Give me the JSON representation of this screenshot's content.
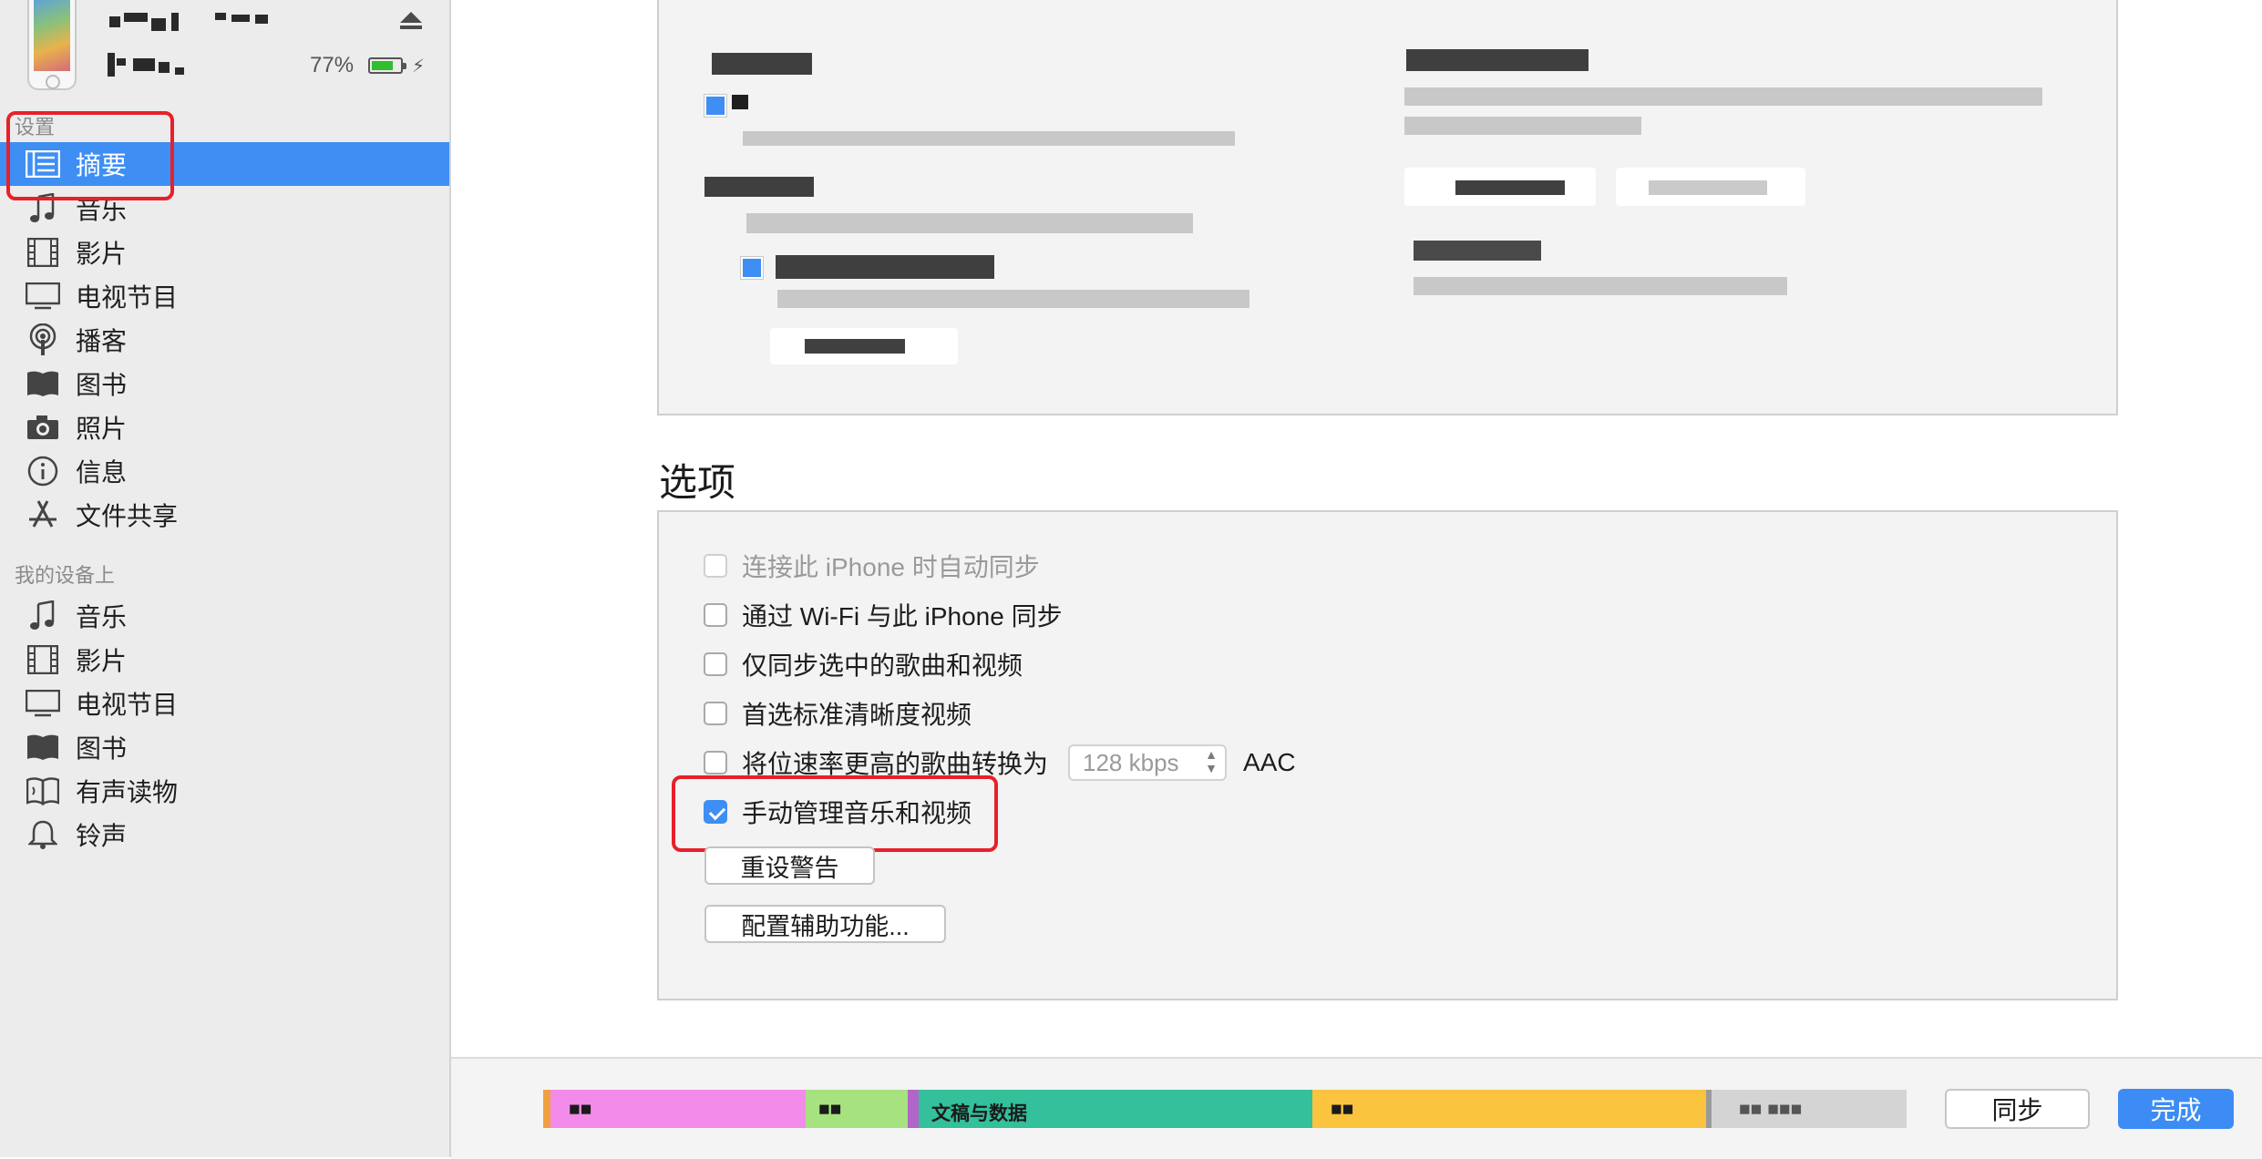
{
  "device": {
    "name_redacted": "■■■ ■■■■",
    "capacity_redacted": "■ ■■■",
    "battery_percent": "77%",
    "battery_level": 0.77,
    "charging_glyph": "⚡"
  },
  "sidebar": {
    "settings_header": "设置",
    "settings_items": [
      {
        "label": "摘要",
        "icon": "list-icon",
        "selected": true
      },
      {
        "label": "音乐",
        "icon": "music-note-icon"
      },
      {
        "label": "影片",
        "icon": "film-icon"
      },
      {
        "label": "电视节目",
        "icon": "tv-icon"
      },
      {
        "label": "播客",
        "icon": "podcast-icon"
      },
      {
        "label": "图书",
        "icon": "book-icon"
      },
      {
        "label": "照片",
        "icon": "camera-icon"
      },
      {
        "label": "信息",
        "icon": "info-icon"
      },
      {
        "label": "文件共享",
        "icon": "app-store-icon"
      }
    ],
    "on_device_header": "我的设备上",
    "device_items": [
      {
        "label": "音乐",
        "icon": "music-note-icon"
      },
      {
        "label": "影片",
        "icon": "film-icon"
      },
      {
        "label": "电视节目",
        "icon": "tv-icon"
      },
      {
        "label": "图书",
        "icon": "book-icon"
      },
      {
        "label": "有声读物",
        "icon": "audiobook-icon"
      },
      {
        "label": "铃声",
        "icon": "bell-icon"
      }
    ]
  },
  "backup_panel": {
    "note": "content pixelated/redacted in screenshot"
  },
  "options": {
    "title": "选项",
    "items": [
      {
        "label": "连接此 iPhone 时自动同步",
        "checked": false,
        "disabled": true
      },
      {
        "label": "通过 Wi-Fi 与此 iPhone 同步",
        "checked": false,
        "disabled": false
      },
      {
        "label": "仅同步选中的歌曲和视频",
        "checked": false,
        "disabled": false
      },
      {
        "label": "首选标准清晰度视频",
        "checked": false,
        "disabled": false
      },
      {
        "label": "将位速率更高的歌曲转换为",
        "checked": false,
        "disabled": false
      },
      {
        "label": "手动管理音乐和视频",
        "checked": true,
        "disabled": false
      }
    ],
    "bitrate_value": "128 kbps",
    "bitrate_format": "AAC",
    "reset_warnings": "重设警告",
    "configure_accessibility": "配置辅助功能..."
  },
  "storage_bar": {
    "segments": [
      {
        "color": "#f28bea",
        "label": "■■"
      },
      {
        "color": "#a6e27f",
        "label": "■■"
      },
      {
        "color": "#33c09a",
        "label": "文稿与数据"
      },
      {
        "color": "#fbc43f",
        "label": "■■"
      },
      {
        "color": "#d4d4d4",
        "label": "■■ ■■■"
      }
    ]
  },
  "footer": {
    "sync_label": "同步",
    "done_label": "完成"
  },
  "colors": {
    "accent": "#3e8ef4",
    "highlight": "#e8202a"
  }
}
